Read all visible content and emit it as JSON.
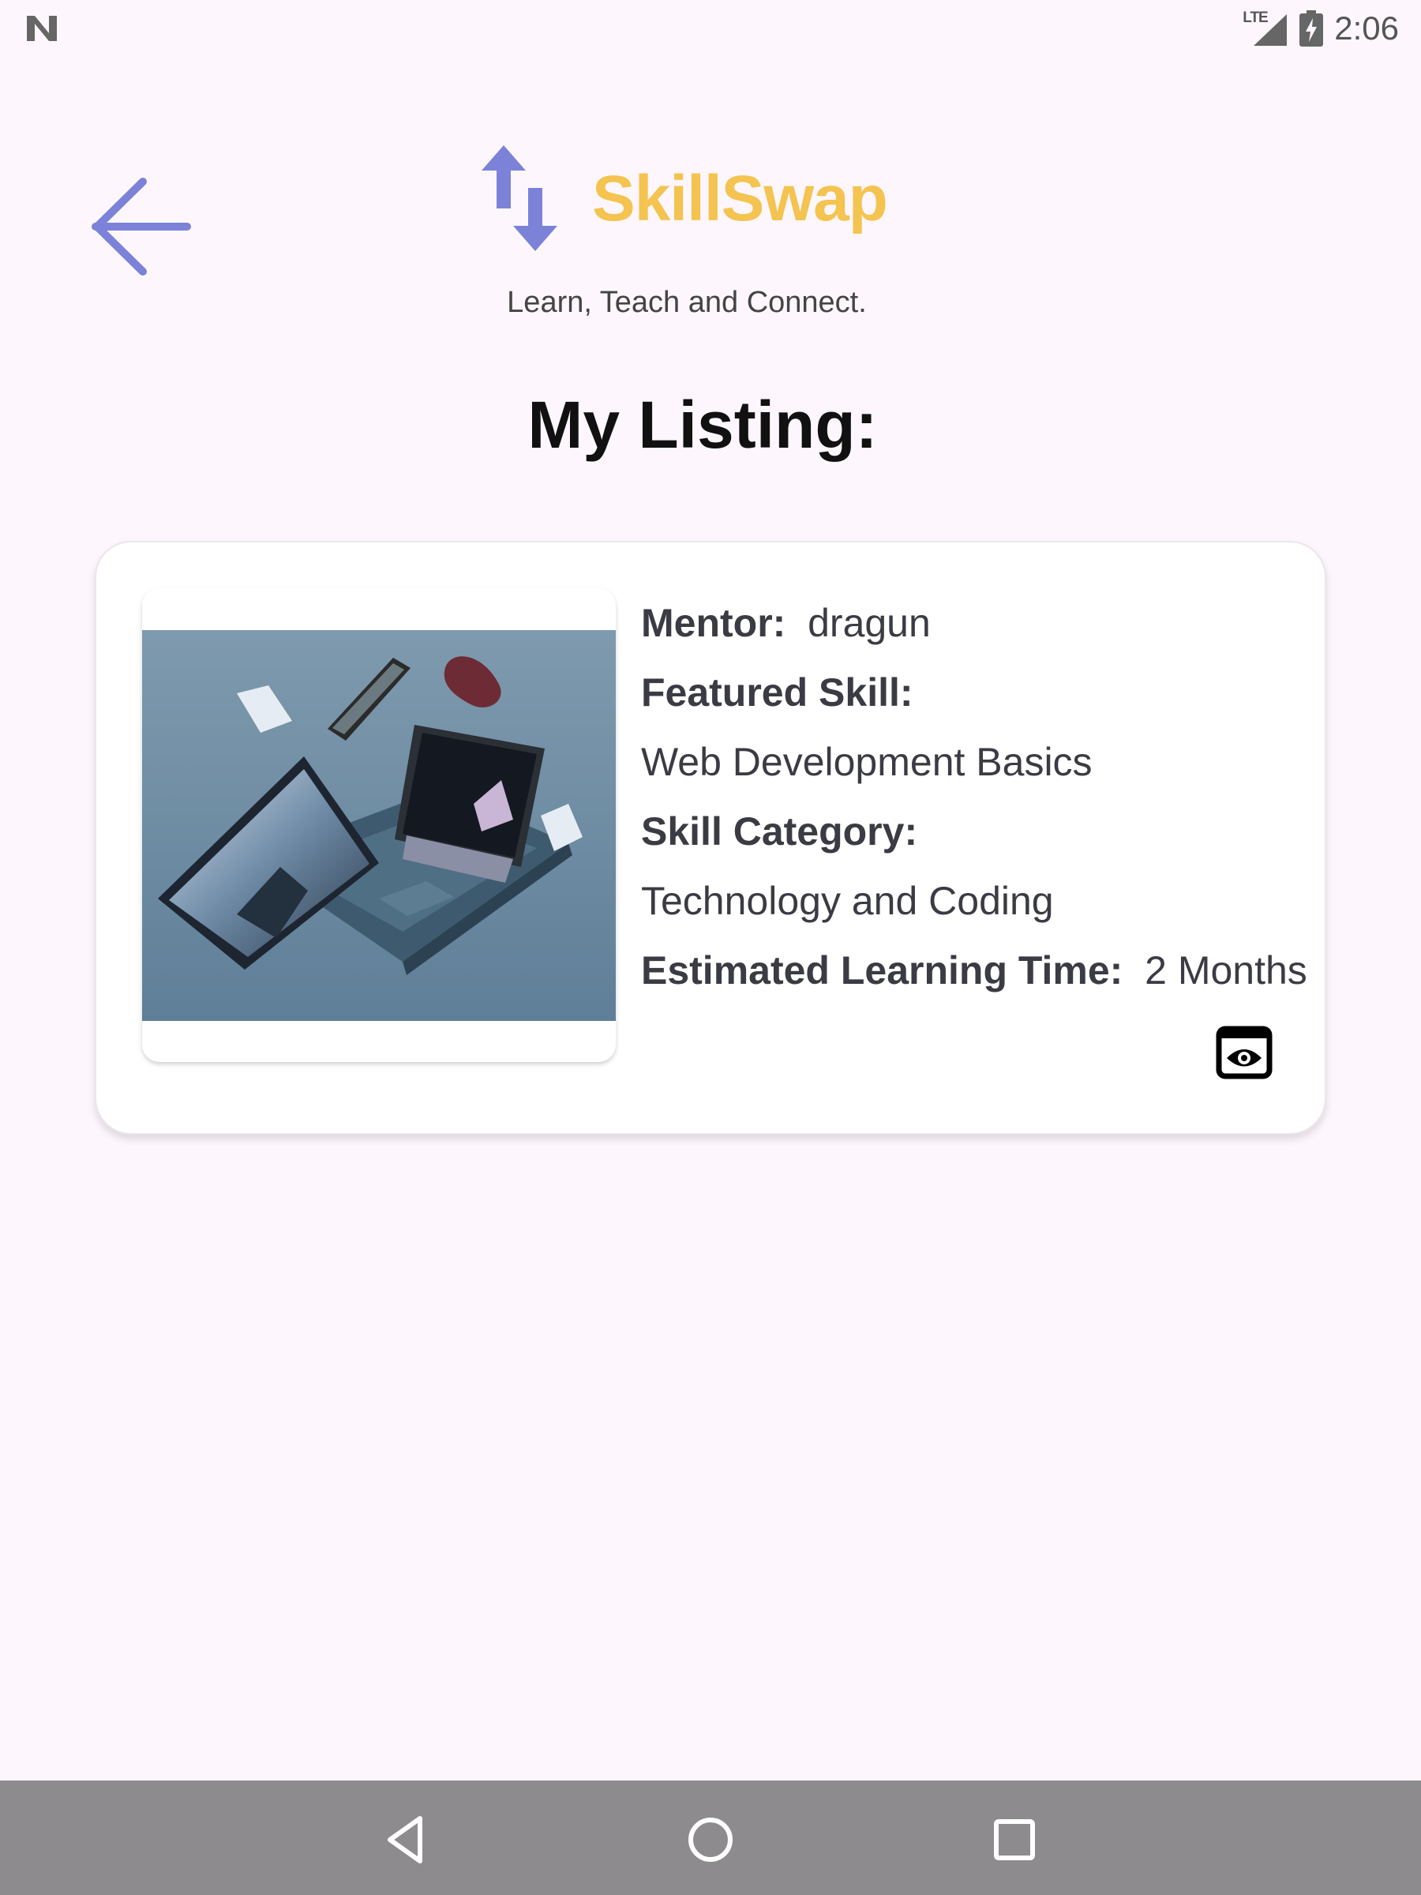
{
  "status_bar": {
    "network": "LTE",
    "time": "2:06"
  },
  "header": {
    "brand": "SkillSwap",
    "tagline": "Learn, Teach and Connect."
  },
  "page": {
    "title": "My Listing:"
  },
  "listing": {
    "image_description": "laptop-devices-photo",
    "mentor_label": "Mentor:",
    "mentor_value": "dragun",
    "featured_skill_label": "Featured Skill:",
    "featured_skill_value": "Web Development Basics",
    "category_label": "Skill Category:",
    "category_value": "Technology and Coding",
    "time_label": "Estimated Learning Time:",
    "time_value": "2 Months"
  },
  "colors": {
    "accent": "#7b82d8",
    "brand": "#f4c350",
    "background": "#fdf7fd",
    "navbar": "#8e8b8f"
  },
  "icons": {
    "back": "arrow-left-icon",
    "logo": "swap-arrows-icon",
    "view": "eye-icon"
  }
}
